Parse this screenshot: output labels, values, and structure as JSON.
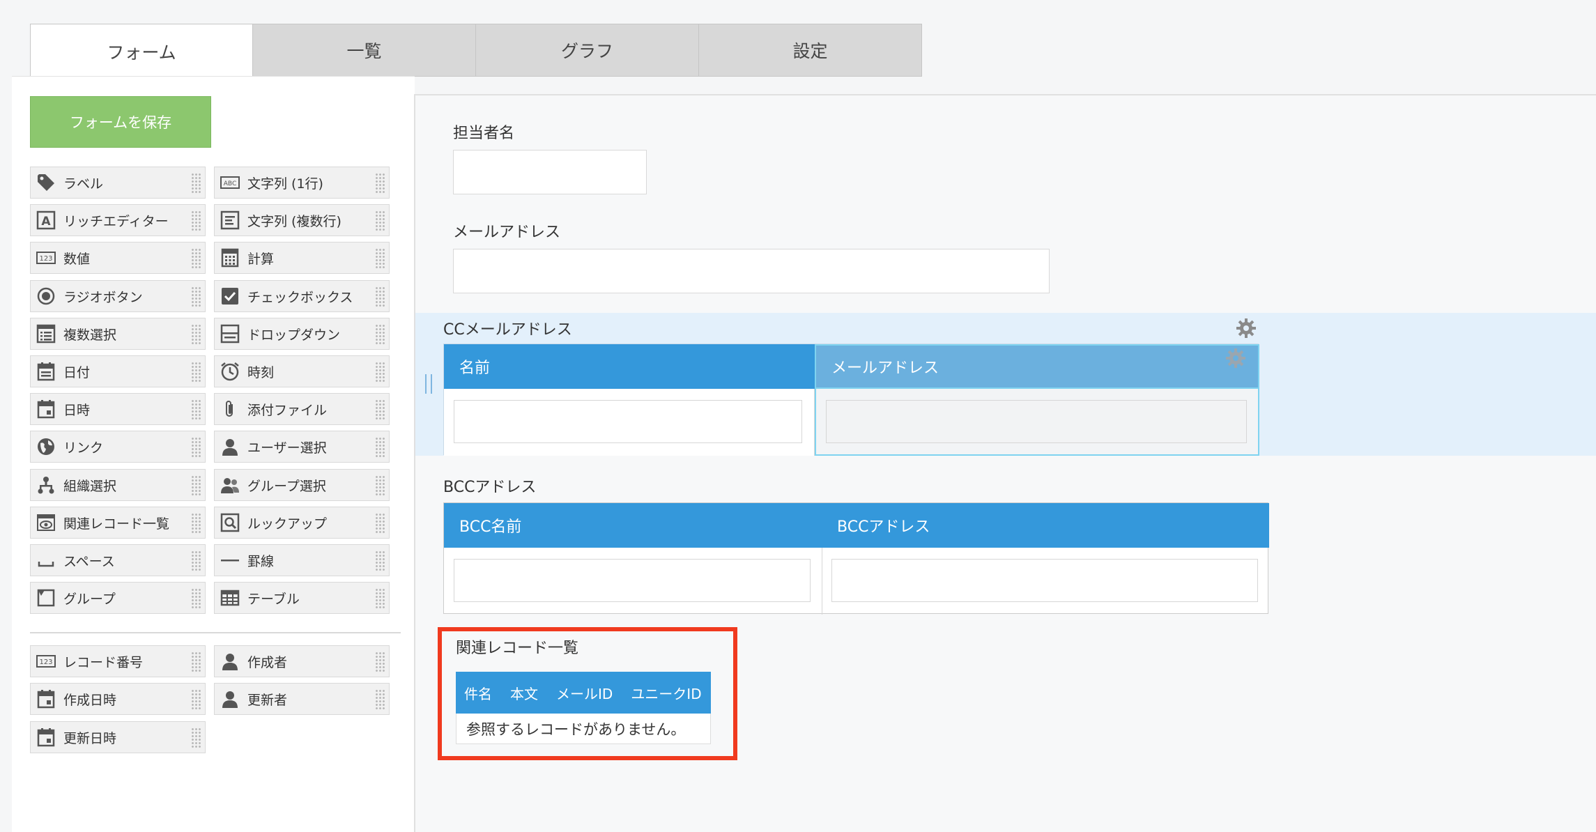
{
  "tabs": [
    "フォーム",
    "一覧",
    "グラフ",
    "設定"
  ],
  "save_button": "フォームを保存",
  "palette": [
    {
      "label": "ラベル",
      "icon": "tag-icon"
    },
    {
      "label": "文字列 (1行)",
      "icon": "abc-text-icon"
    },
    {
      "label": "リッチエディター",
      "icon": "rich-editor-icon"
    },
    {
      "label": "文字列 (複数行)",
      "icon": "multiline-text-icon"
    },
    {
      "label": "数値",
      "icon": "number-123-icon"
    },
    {
      "label": "計算",
      "icon": "calculator-icon"
    },
    {
      "label": "ラジオボタン",
      "icon": "radio-button-icon"
    },
    {
      "label": "チェックボックス",
      "icon": "checkbox-icon"
    },
    {
      "label": "複数選択",
      "icon": "multi-select-list-icon"
    },
    {
      "label": "ドロップダウン",
      "icon": "dropdown-icon"
    },
    {
      "label": "日付",
      "icon": "calendar-icon"
    },
    {
      "label": "時刻",
      "icon": "clock-icon"
    },
    {
      "label": "日時",
      "icon": "datetime-calendar-icon"
    },
    {
      "label": "添付ファイル",
      "icon": "paperclip-icon"
    },
    {
      "label": "リンク",
      "icon": "globe-icon"
    },
    {
      "label": "ユーザー選択",
      "icon": "user-icon"
    },
    {
      "label": "組織選択",
      "icon": "org-chart-icon"
    },
    {
      "label": "グループ選択",
      "icon": "group-users-icon"
    },
    {
      "label": "関連レコード一覧",
      "icon": "related-records-eye-icon"
    },
    {
      "label": "ルックアップ",
      "icon": "lookup-magnifier-icon"
    },
    {
      "label": "スペース",
      "icon": "space-icon"
    },
    {
      "label": "罫線",
      "icon": "horizontal-line-icon"
    },
    {
      "label": "グループ",
      "icon": "group-folder-icon"
    },
    {
      "label": "テーブル",
      "icon": "table-icon"
    }
  ],
  "system_fields": [
    {
      "label": "レコード番号",
      "icon": "number-123-icon"
    },
    {
      "label": "作成者",
      "icon": "user-icon"
    },
    {
      "label": "作成日時",
      "icon": "datetime-calendar-icon"
    },
    {
      "label": "更新者",
      "icon": "user-icon"
    },
    {
      "label": "更新日時",
      "icon": "datetime-calendar-icon"
    }
  ],
  "form": {
    "assignee_label": "担当者名",
    "email_label": "メールアドレス",
    "cc_label": "CCメールアドレス",
    "cc_cols": [
      "名前",
      "メールアドレス"
    ],
    "bcc_label": "BCCアドレス",
    "bcc_cols": [
      "BCC名前",
      "BCCアドレス"
    ],
    "related_label": "関連レコード一覧",
    "related_cols": [
      "件名",
      "本文",
      "メールID",
      "ユニークID"
    ],
    "related_empty": "参照するレコードがありません。"
  },
  "colors": {
    "accent_blue": "#3498db",
    "save_green": "#8cc76e",
    "highlight_red": "#f03a1f",
    "selected_band": "#e3f0fb"
  }
}
